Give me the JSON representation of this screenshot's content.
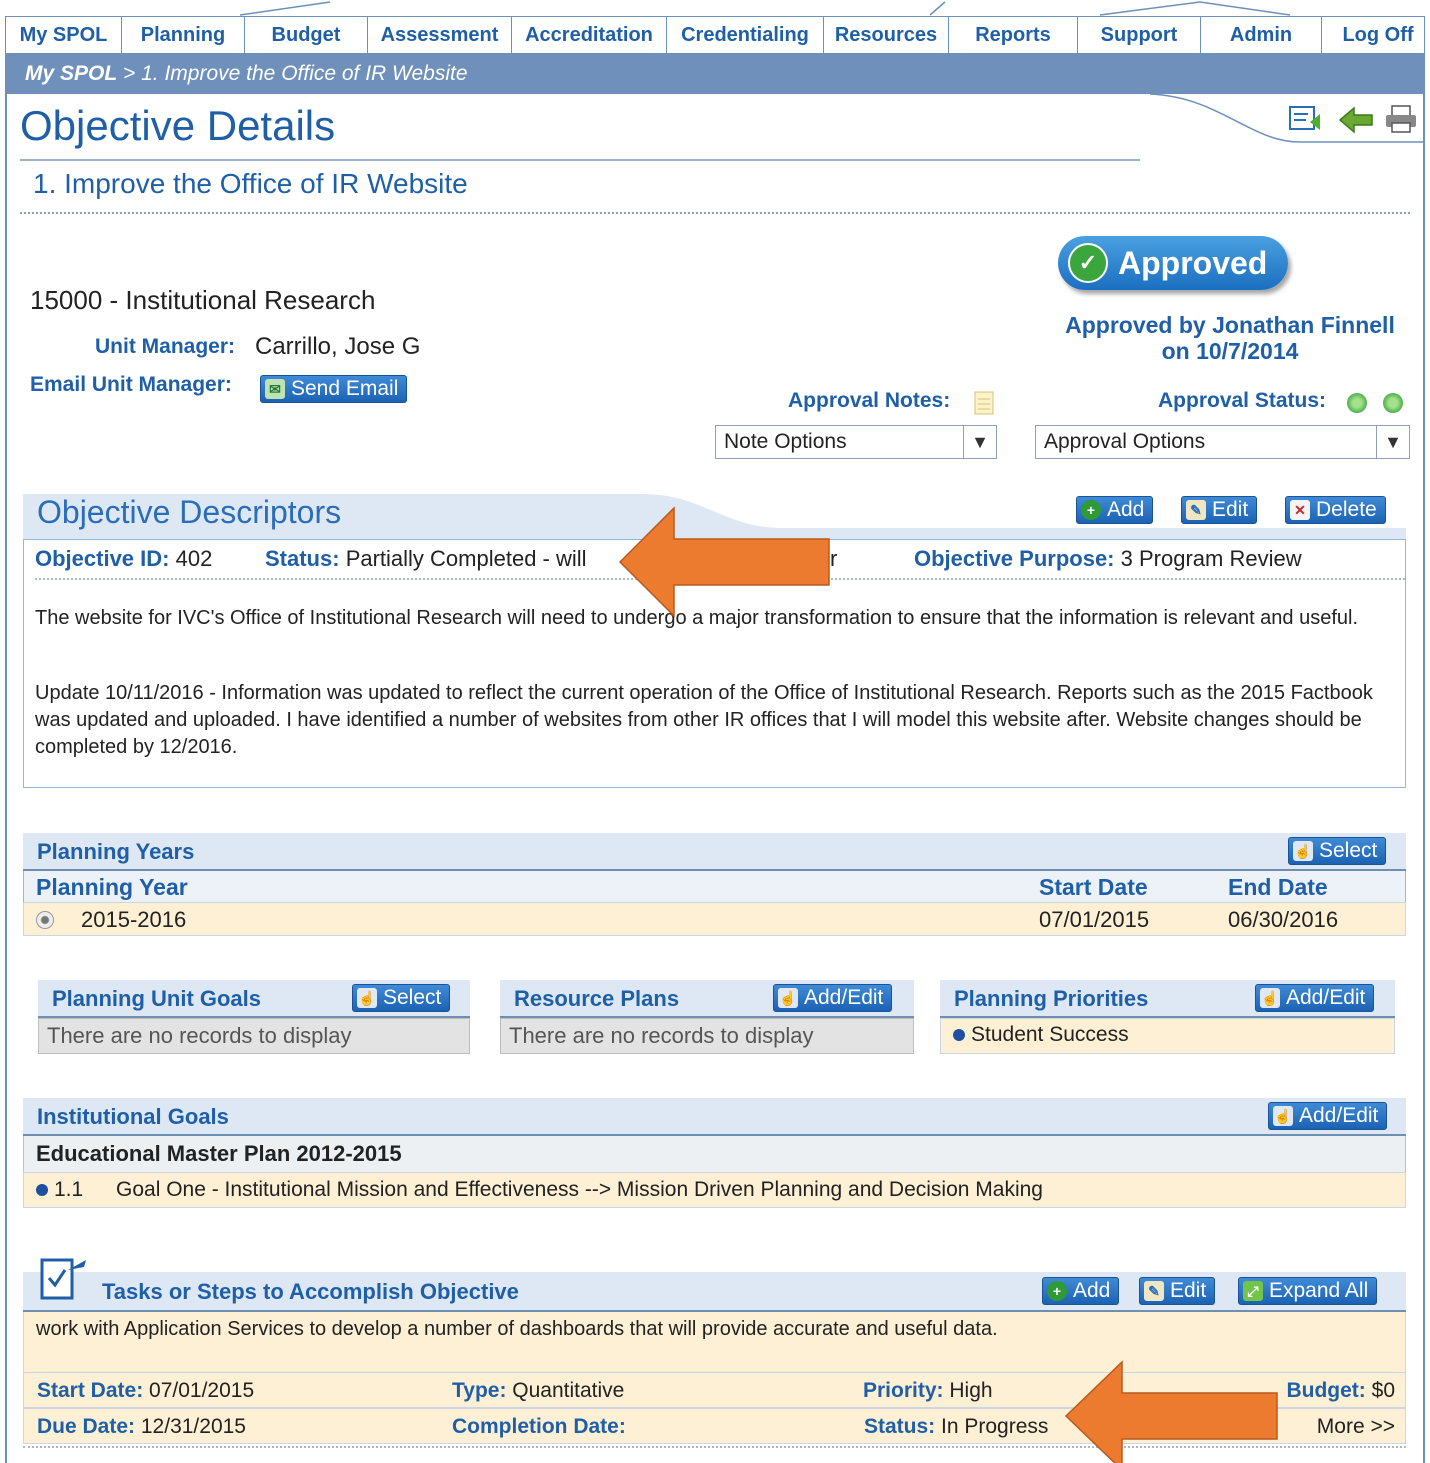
{
  "nav": {
    "tabs": [
      "My SPOL",
      "Planning",
      "Budget",
      "Assessment",
      "Accreditation",
      "Credentialing",
      "Resources",
      "Reports",
      "Support",
      "Admin",
      "Log Off"
    ]
  },
  "breadcrumb": {
    "root": "My SPOL",
    "separator": " > ",
    "current": "1. Improve the Office of IR Website"
  },
  "page": {
    "title": "Objective Details",
    "subtitle": "1. Improve the Office of IR Website"
  },
  "unit": {
    "name": "15000 - Institutional Research",
    "manager_label": "Unit Manager:",
    "manager_value": "Carrillo, Jose G",
    "email_label": "Email Unit Manager:",
    "send_email": "Send Email"
  },
  "approval": {
    "badge": "Approved",
    "approved_by_line1": "Approved by Jonathan Finnell",
    "approved_by_line2": "on 10/7/2014",
    "notes_label": "Approval Notes:",
    "status_label": "Approval Status:",
    "note_options": "Note Options",
    "approval_options": "Approval Options",
    "status_color": "#49b34a"
  },
  "descriptors": {
    "title": "Objective Descriptors",
    "add": "Add",
    "edit": "Edit",
    "delete": "Delete",
    "id_label": "Objective ID:",
    "id_value": "402",
    "status_label": "Status:",
    "status_value": "Partially Completed - will",
    "status_tail": "r",
    "purpose_label": "Objective Purpose:",
    "purpose_value": "3 Program Review",
    "para1": "The website for IVC's Office of Institutional Research will need to undergo a major transformation to ensure that the information is relevant and useful.",
    "para2": "Update 10/11/2016 - Information was updated to reflect the current operation of the Office of Institutional Research. Reports such as the 2015 Factbook was updated and uploaded. I have identified a number of websites from other IR offices that I will model this website after. Website changes should be completed by 12/2016."
  },
  "planning_years": {
    "title": "Planning Years",
    "select": "Select",
    "col_year": "Planning Year",
    "col_start": "Start Date",
    "col_end": "End Date",
    "rows": [
      {
        "year": "2015-2016",
        "start": "07/01/2015",
        "end": "06/30/2016"
      }
    ]
  },
  "unit_goals": {
    "title": "Planning Unit Goals",
    "button": "Select",
    "empty": "There are no records to display"
  },
  "resource_plans": {
    "title": "Resource Plans",
    "button": "Add/Edit",
    "empty": "There are no records to display"
  },
  "priorities": {
    "title": "Planning Priorities",
    "button": "Add/Edit",
    "items": [
      "Student Success"
    ]
  },
  "inst_goals": {
    "title": "Institutional Goals",
    "button": "Add/Edit",
    "plan": "Educational Master Plan 2012-2015",
    "goal_num": "1.1",
    "goal_text": "Goal One - Institutional Mission and Effectiveness --> Mission Driven Planning and Decision Making"
  },
  "tasks": {
    "title": "Tasks or Steps to Accomplish Objective",
    "add": "Add",
    "edit": "Edit",
    "expand": "Expand All",
    "description": "work with Application Services to develop a number of dashboards that will provide accurate and useful data.",
    "start_label": "Start Date:",
    "start_value": "07/01/2015",
    "type_label": "Type:",
    "type_value": "Quantitative",
    "priority_label": "Priority:",
    "priority_value": "High",
    "budget_label": "Budget:",
    "budget_value": "$0",
    "due_label": "Due Date:",
    "due_value": "12/31/2015",
    "completion_label": "Completion Date:",
    "completion_value": "",
    "status_label": "Status:",
    "status_value": "In Progress",
    "more": "More >>"
  },
  "annotation_color": "#ec7a2f"
}
